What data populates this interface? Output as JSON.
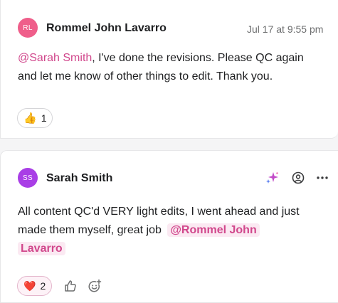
{
  "comments": [
    {
      "author": "Rommel John Lavarro",
      "initials": "RL",
      "avatar_color": "#ef5e8a",
      "timestamp": "Jul 17 at 9:55 pm",
      "mention": "@Sarah Smith",
      "text_line1_rest": ", I've done the revisions. Please QC again",
      "text_line2": "and let me know of other things to edit. Thank you.",
      "reaction": {
        "emoji": "👍",
        "count": "1"
      }
    },
    {
      "author": "Sarah Smith",
      "initials": "SS",
      "avatar_color": "#a93ee6",
      "text_line1": "All content QC'd VERY light edits, I went ahead and just",
      "text_line2_start": "made them myself, great job",
      "mention_part1": "@Rommel John",
      "mention_part2": "Lavarro",
      "reaction": {
        "emoji": "❤️",
        "count": "2"
      },
      "icons": [
        "ai-sparkle-icon",
        "mention-icon",
        "more-icon",
        "thumbs-up-icon",
        "add-emoji-icon"
      ]
    }
  ]
}
